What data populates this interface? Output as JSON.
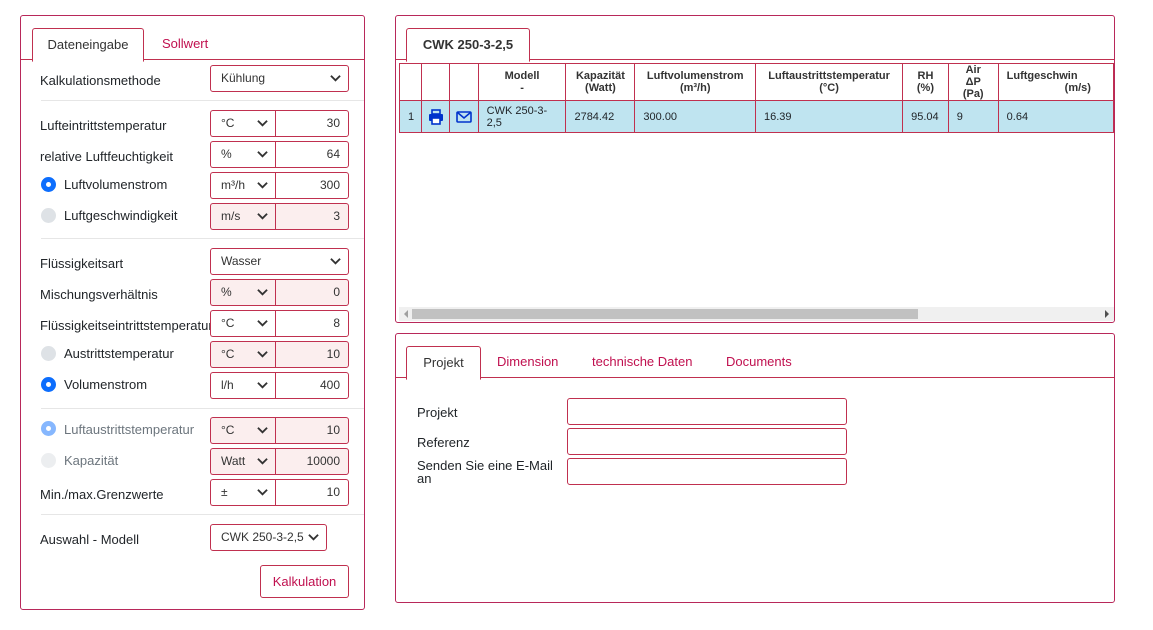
{
  "left": {
    "tabs": [
      "Dateneingabe",
      "Sollwert"
    ],
    "fields": {
      "kalkulationsmethode": {
        "label": "Kalkulationsmethode",
        "value": "Kühlung"
      },
      "lufteintritt": {
        "label": "Lufteintrittstemperatur",
        "unit": "°C",
        "value": "30"
      },
      "feuchte": {
        "label": "relative Luftfeuchtigkeit",
        "unit": "%",
        "value": "64"
      },
      "luftvolumen": {
        "label": "Luftvolumenstrom",
        "unit": "m³/h",
        "value": "300"
      },
      "luftgeschw": {
        "label": "Luftgeschwindigkeit",
        "unit": "m/s",
        "value": "3"
      },
      "fluessigkeitsart": {
        "label": "Flüssigkeitsart",
        "value": "Wasser"
      },
      "mischung": {
        "label": "Mischungsverhältnis",
        "unit": "%",
        "value": "0"
      },
      "fl_eintritt": {
        "label": "Flüssigkeitseintrittstemperatur",
        "unit": "°C",
        "value": "8"
      },
      "austritt": {
        "label": "Austrittstemperatur",
        "unit": "°C",
        "value": "10"
      },
      "volumenstrom": {
        "label": "Volumenstrom",
        "unit": "l/h",
        "value": "400"
      },
      "luftaustritt": {
        "label": "Luftaustrittstemperatur",
        "unit": "°C",
        "value": "10"
      },
      "kapazitaet": {
        "label": "Kapazität",
        "unit": "Watt",
        "value": "10000"
      },
      "grenzwerte": {
        "label": "Min./max.Grenzwerte",
        "unit": "±",
        "value": "10"
      },
      "modell": {
        "label": "Auswahl - Modell",
        "value": "CWK 250-3-2,5"
      }
    },
    "calc_button": "Kalkulation"
  },
  "results": {
    "tab": "CWK 250-3-2,5",
    "columns": [
      {
        "line1": "Modell",
        "line2": "-"
      },
      {
        "line1": "Kapazität",
        "line2": "(Watt)"
      },
      {
        "line1": "Luftvolumenstrom",
        "line2": "(m³/h)"
      },
      {
        "line1": "Luftaustrittstemperatur",
        "line2": "(°C)"
      },
      {
        "line1": "RH",
        "line2": "(%)"
      },
      {
        "line1": "Air ΔP",
        "line2": "(Pa)"
      },
      {
        "line1": "Luftgeschwin",
        "line2": "(m/s)"
      }
    ],
    "row": {
      "index": "1",
      "modell": "CWK 250-3-2,5",
      "kapazitaet": "2784.42",
      "luftvolumen": "300.00",
      "luftaustritt": "16.39",
      "rh": "95.04",
      "airdp": "9",
      "luftgeschw": "0.64"
    },
    "icons": [
      "printer-icon",
      "envelope-icon"
    ]
  },
  "project": {
    "tabs": [
      "Projekt",
      "Dimension",
      "technische Daten",
      "Documents"
    ],
    "fields": [
      {
        "label": "Projekt",
        "value": ""
      },
      {
        "label": "Referenz",
        "value": ""
      },
      {
        "label_line1": "Senden Sie eine E-Mail",
        "label_line2": "an",
        "value": ""
      }
    ]
  },
  "colors": {
    "accent": "#c0104f",
    "border": "#c0304f",
    "row_highlight": "#bfe4f0",
    "radio_active": "#0d6efd"
  }
}
